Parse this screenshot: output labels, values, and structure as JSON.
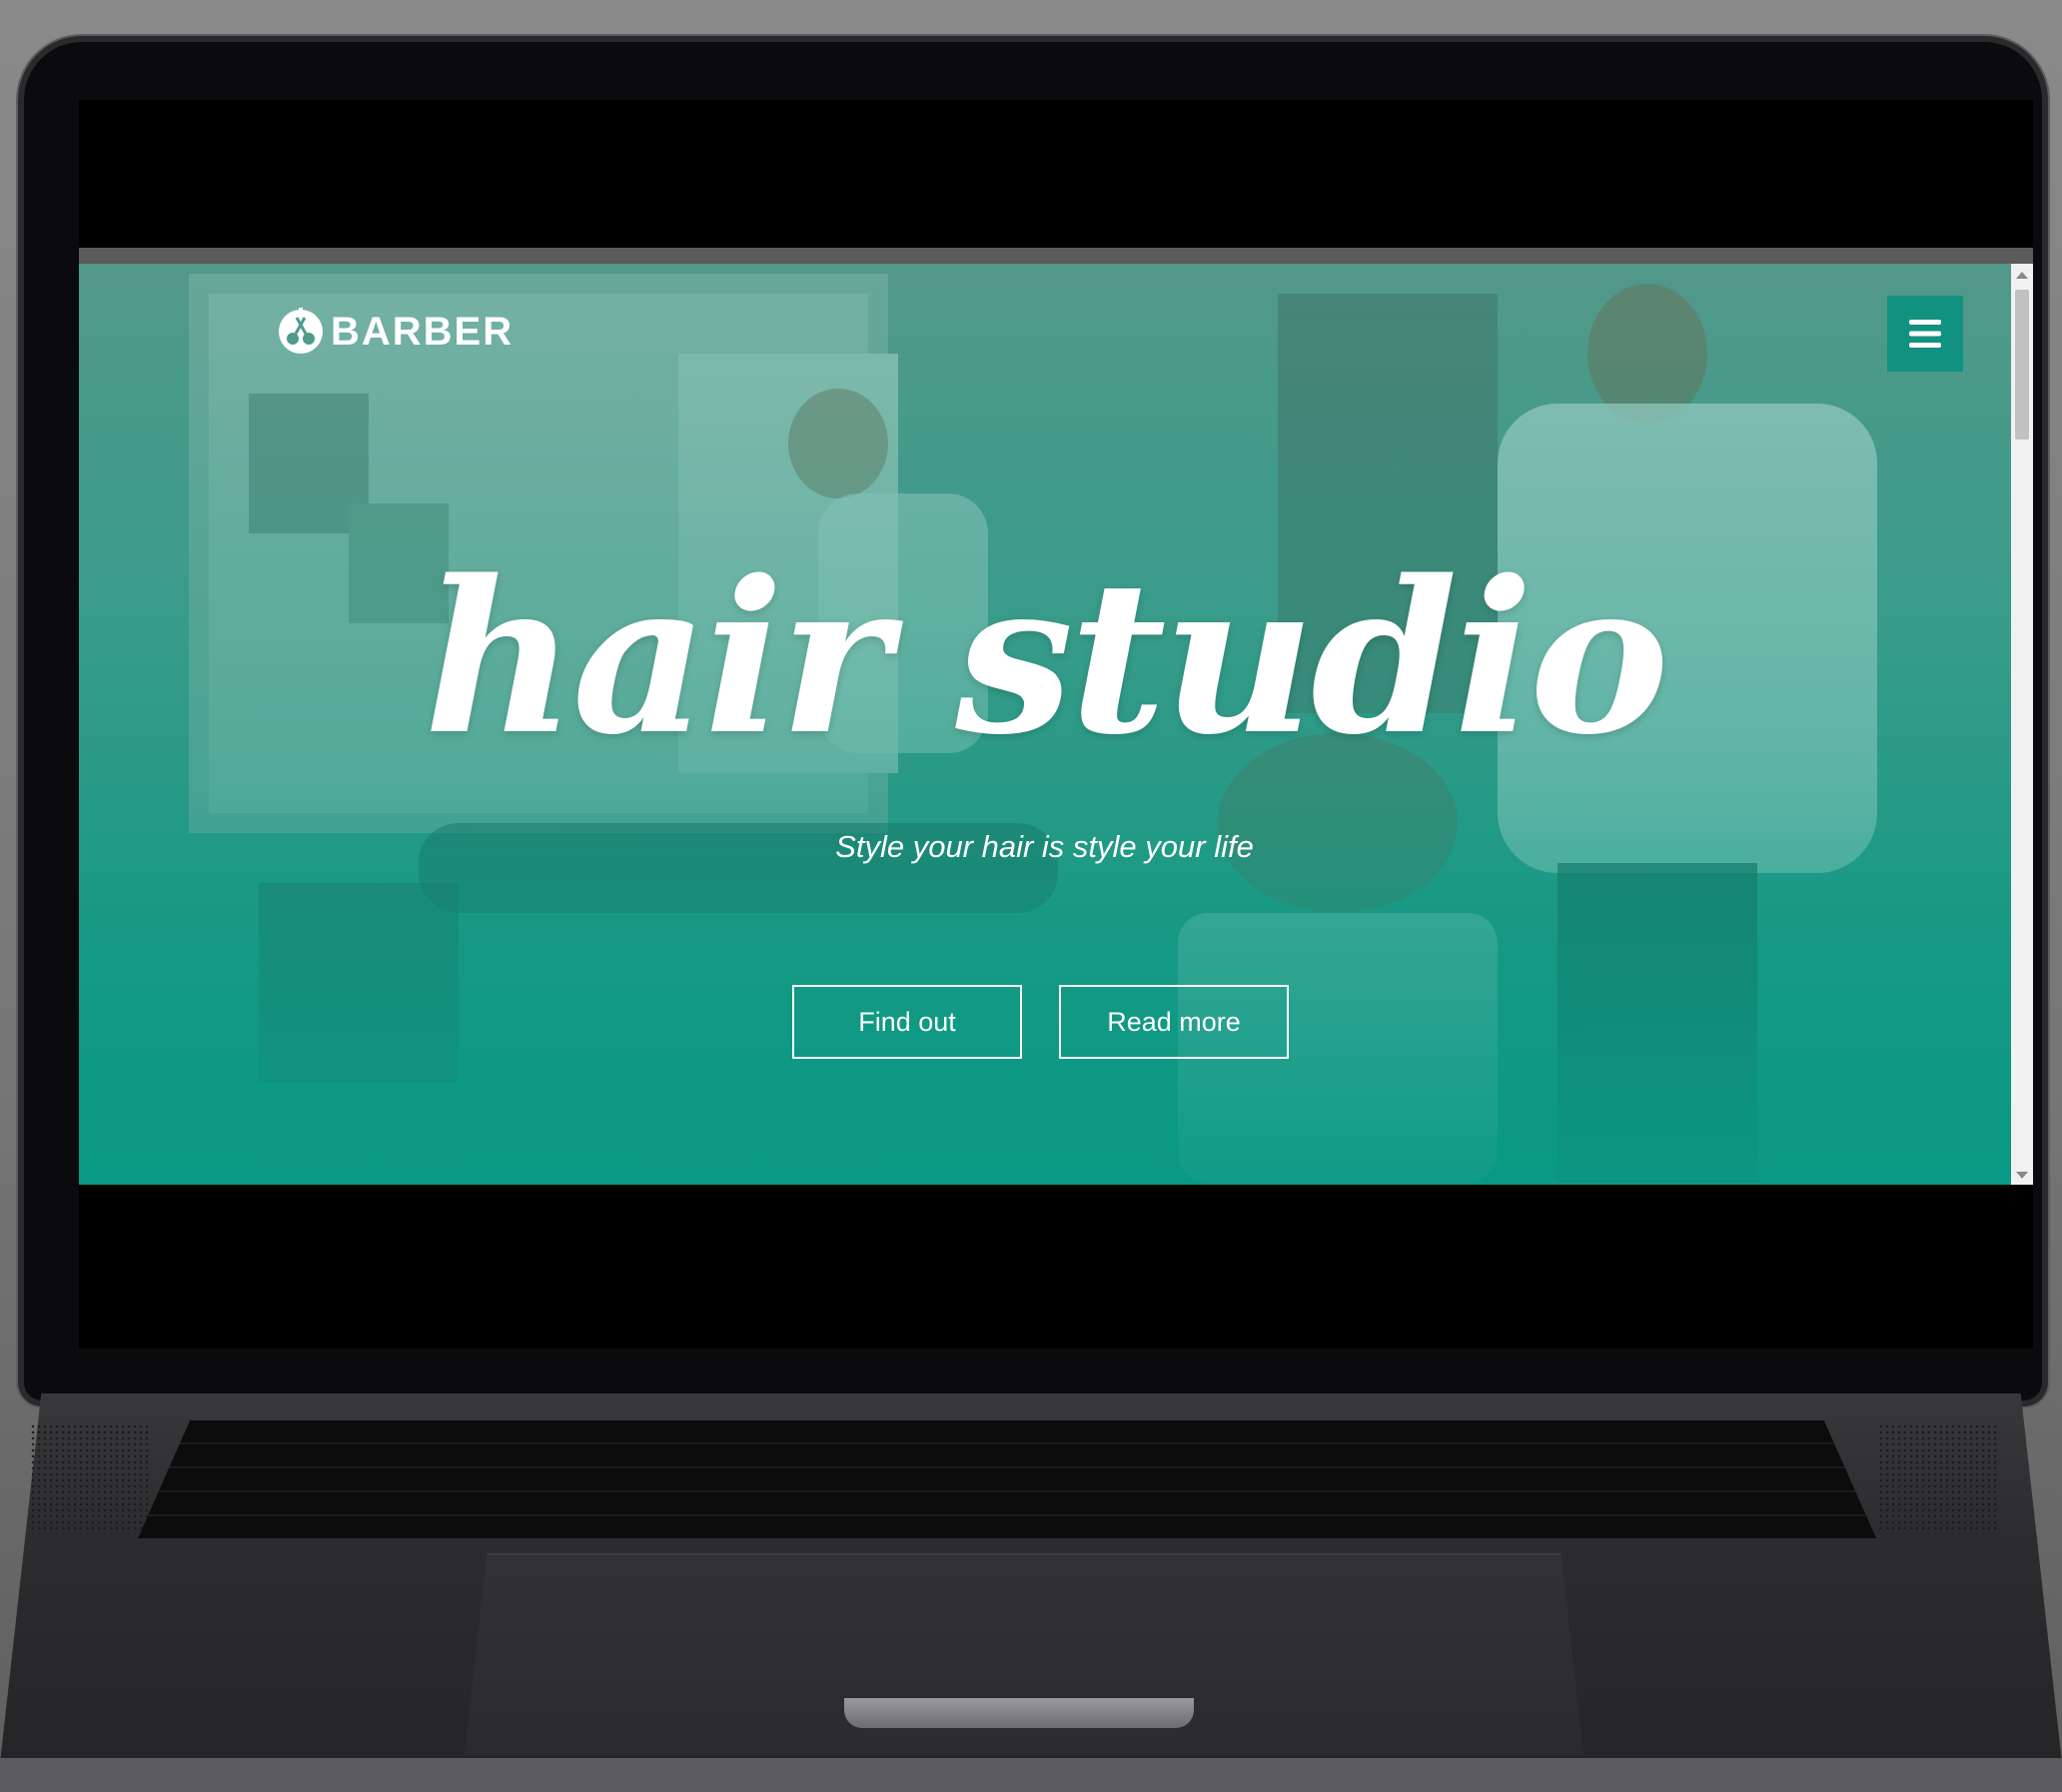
{
  "brand": {
    "name": "BARBER",
    "logo_icon": "scissors-logo-icon"
  },
  "header": {
    "menu_icon": "hamburger-menu-icon",
    "accent_color": "#11917f"
  },
  "hero": {
    "title": "hair studio",
    "subtitle": "Style your hair is style your life",
    "overlay_color": "#0f9a85"
  },
  "buttons": {
    "find_out": "Find out",
    "read_more": "Read more"
  }
}
